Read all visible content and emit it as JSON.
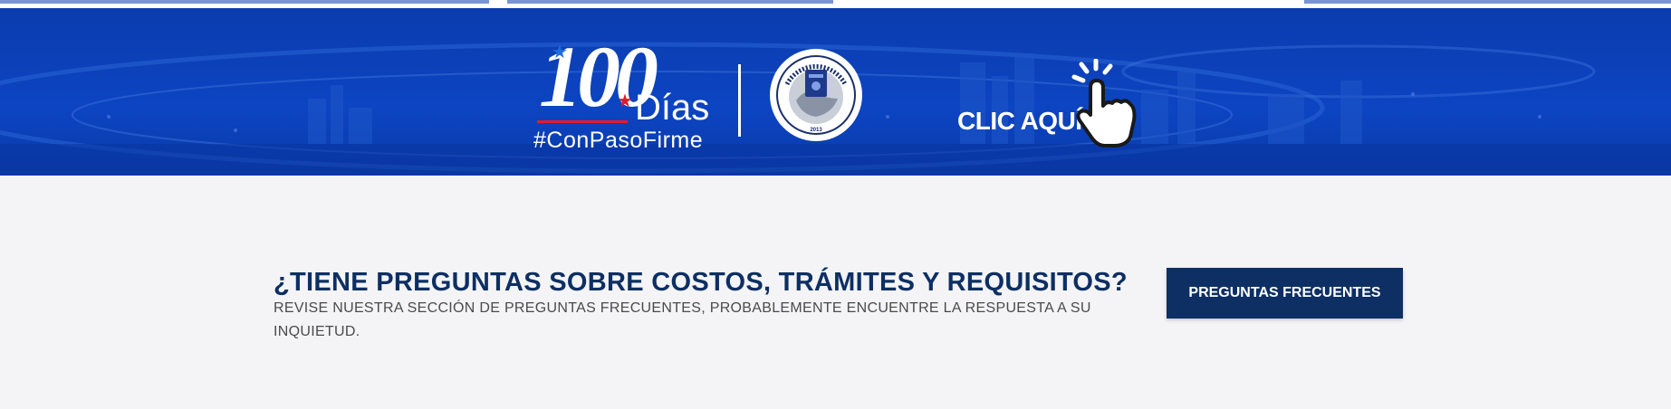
{
  "banner": {
    "logo_number": "100",
    "logo_word": "Días",
    "hashtag": "#ConPasoFirme",
    "seal_top_text": "AUTORIDAD DE PASAPORTES DE PANAMÁ",
    "seal_year": "2013",
    "cta_label": "CLIC AQUÍ",
    "icons": [
      "star-icon",
      "passport-seal-icon",
      "pointing-hand-icon"
    ],
    "colors": {
      "banner_blue": "#0c44c2",
      "accent_red": "#e11b2b"
    }
  },
  "faq": {
    "title": "¿TIENE PREGUNTAS SOBRE COSTOS, TRÁMITES Y REQUISITOS?",
    "description": "REVISE NUESTRA SECCIÓN DE PREGUNTAS FRECUENTES, PROBABLEMENTE ENCUENTRE LA RESPUESTA A SU INQUIETUD.",
    "button_label": "PREGUNTAS FRECUENTES",
    "colors": {
      "navy": "#0d2f63",
      "background": "#f4f4f6"
    }
  }
}
